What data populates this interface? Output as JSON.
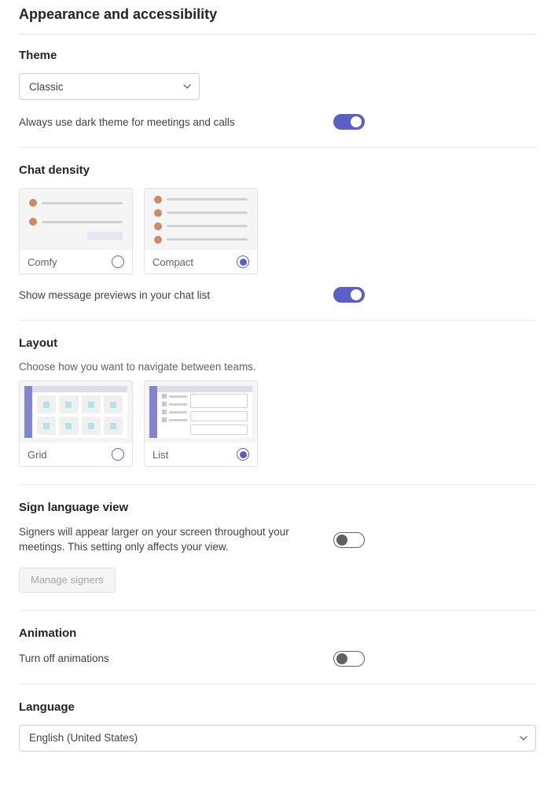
{
  "page_title": "Appearance and accessibility",
  "theme": {
    "title": "Theme",
    "select_value": "Classic",
    "dark_meetings_label": "Always use dark theme for meetings and calls",
    "dark_meetings_on": true
  },
  "chat_density": {
    "title": "Chat density",
    "options": [
      {
        "label": "Comfy",
        "selected": false
      },
      {
        "label": "Compact",
        "selected": true
      }
    ],
    "previews_label": "Show message previews in your chat list",
    "previews_on": true
  },
  "layout": {
    "title": "Layout",
    "desc": "Choose how you want to navigate between teams.",
    "options": [
      {
        "label": "Grid",
        "selected": false
      },
      {
        "label": "List",
        "selected": true
      }
    ]
  },
  "sign_language": {
    "title": "Sign language view",
    "desc": "Signers will appear larger on your screen throughout your meetings. This setting only affects your view.",
    "toggle_on": false,
    "manage_btn": "Manage signers"
  },
  "animation": {
    "title": "Animation",
    "label": "Turn off animations",
    "toggle_on": false
  },
  "language": {
    "title": "Language",
    "select_value": "English (United States)"
  }
}
